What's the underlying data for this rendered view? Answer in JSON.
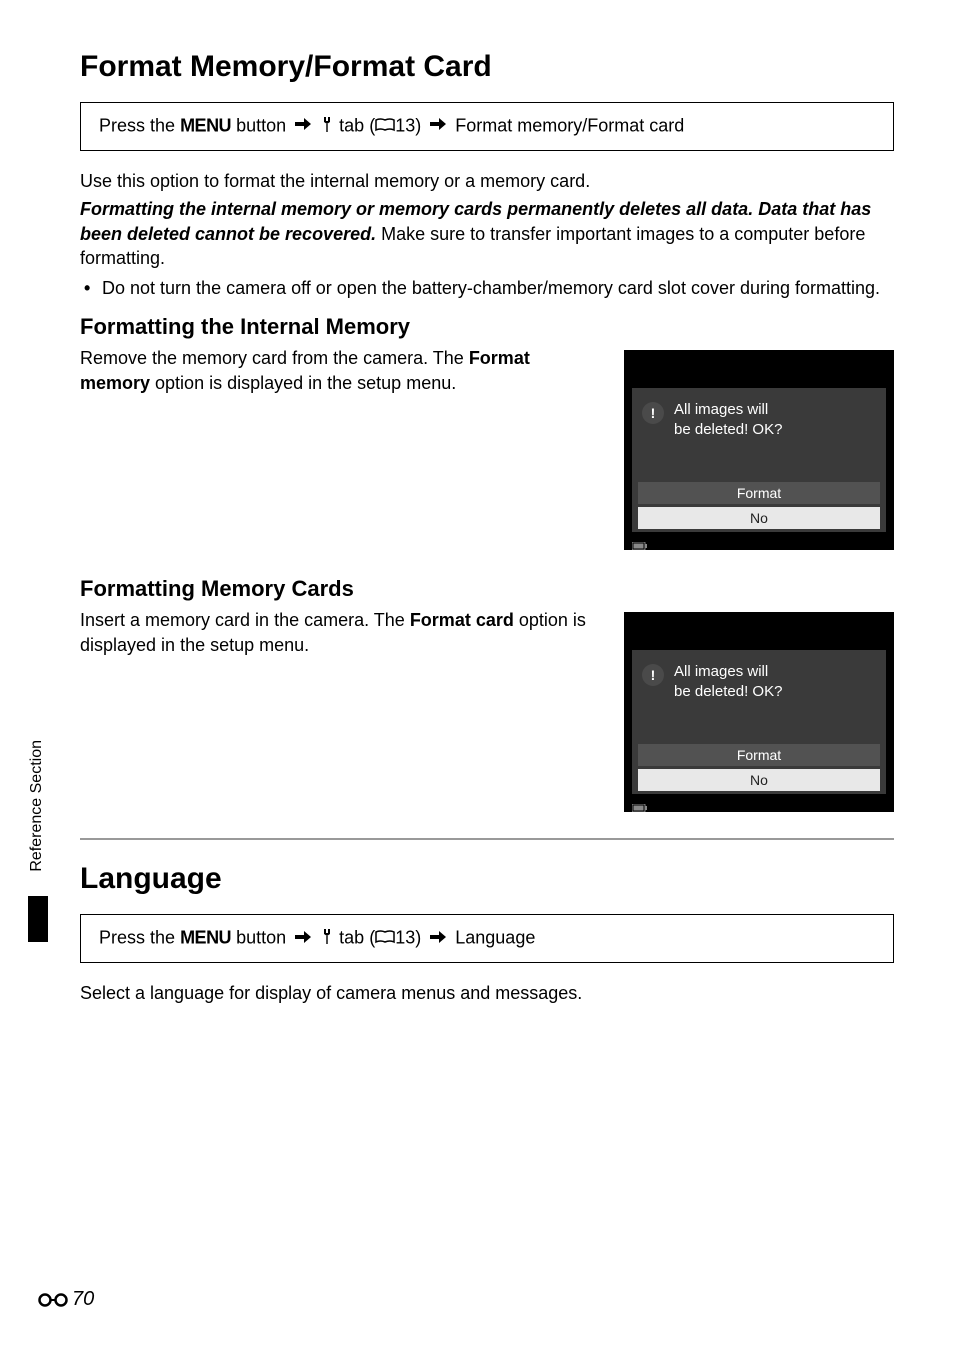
{
  "section1": {
    "title": "Format Memory/Format Card",
    "nav": {
      "press_the": "Press the",
      "menu_label": "MENU",
      "button_text": "button",
      "tab_text": "tab (",
      "page_ref": "13)",
      "destination": "Format memory/Format card"
    },
    "intro": "Use this option to format the internal memory or a memory card.",
    "warning_bold": "Formatting the internal memory or memory cards permanently deletes all data. Data that has been deleted cannot be recovered.",
    "warning_tail": " Make sure to transfer important images to a computer before formatting.",
    "bullet1": "Do not turn the camera off or open the battery-chamber/memory card slot cover during formatting."
  },
  "subsection1": {
    "heading": "Formatting the Internal Memory",
    "text_pre": "Remove the memory card from the camera. The ",
    "text_bold": "Format memory",
    "text_post": " option is displayed in the setup menu."
  },
  "subsection2": {
    "heading": "Formatting Memory Cards",
    "text_pre": "Insert a memory card in the camera. The ",
    "text_bold": "Format card",
    "text_post": " option is displayed in the setup menu."
  },
  "camera_dialog": {
    "msg_line1": "All images will",
    "msg_line2": "be deleted! OK?",
    "btn_format": "Format",
    "btn_no": "No"
  },
  "section2": {
    "title": "Language",
    "nav": {
      "press_the": "Press the",
      "menu_label": "MENU",
      "button_text": "button",
      "tab_text": "tab (",
      "page_ref": "13)",
      "destination": "Language"
    },
    "body": "Select a language for display of camera menus and messages."
  },
  "side_label": "Reference Section",
  "page_number": "70"
}
